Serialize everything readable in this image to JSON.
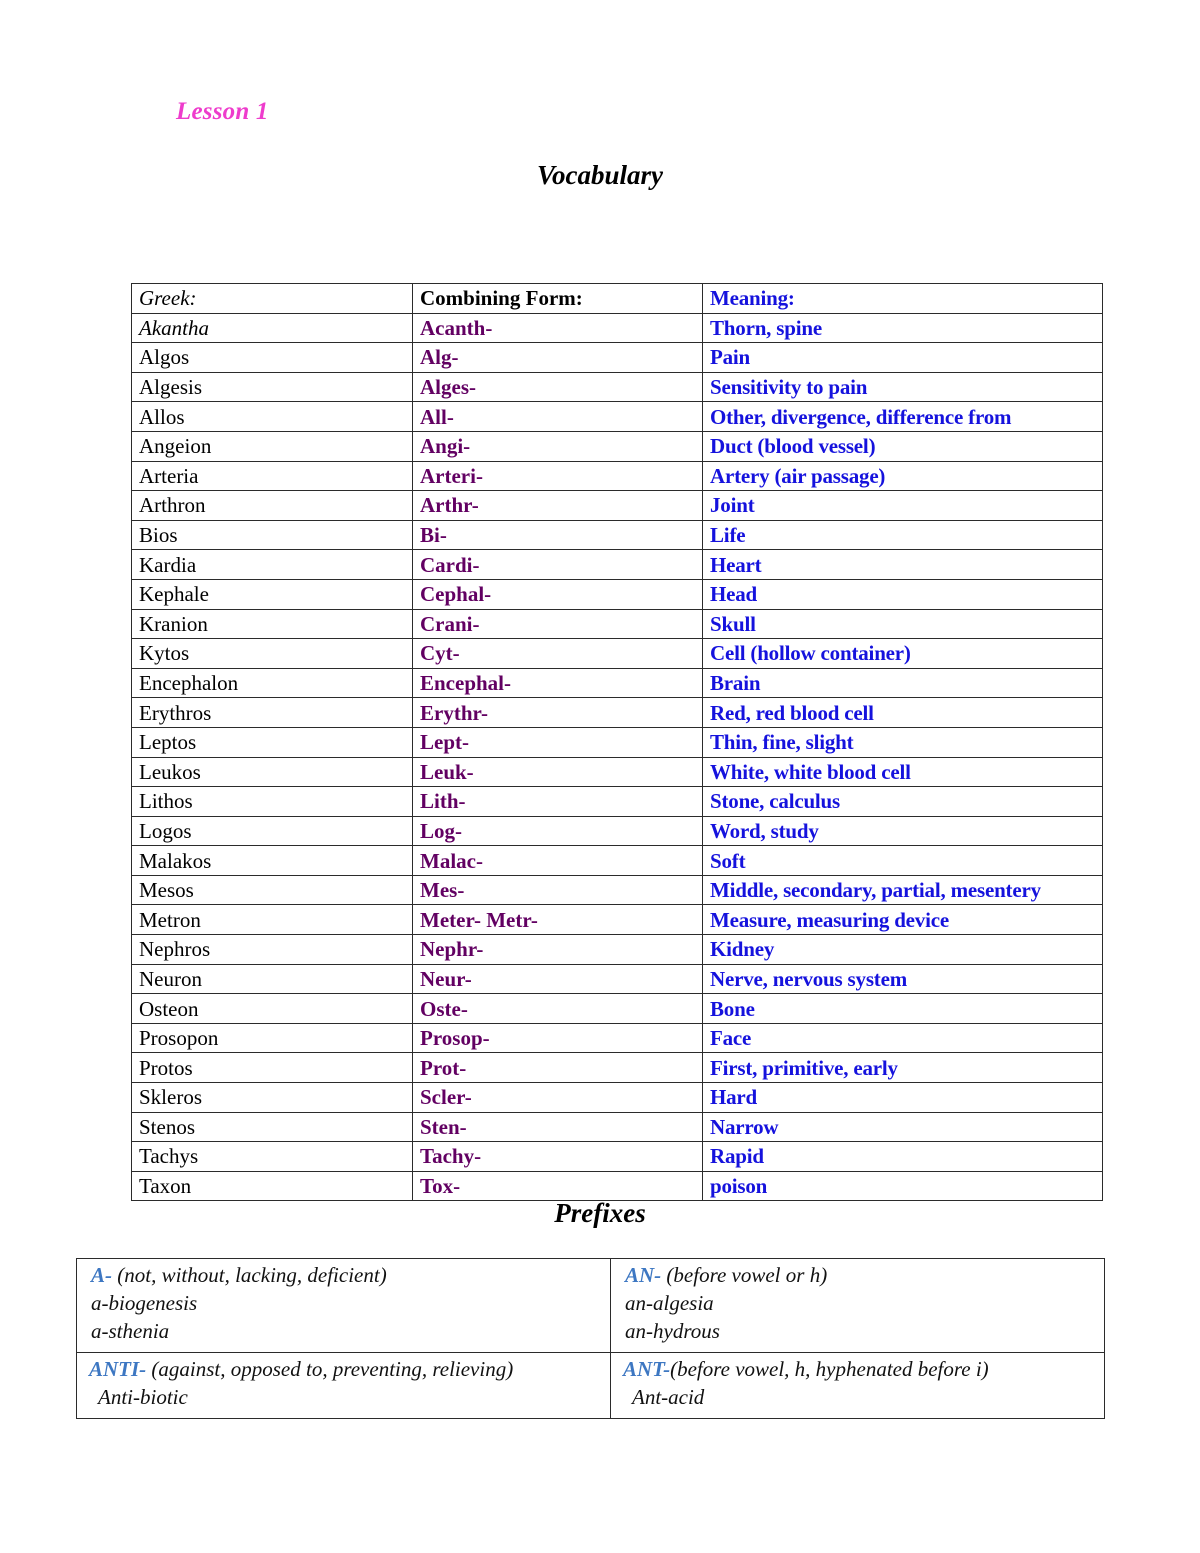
{
  "document": {
    "lesson_title": "Lesson 1",
    "vocabulary_heading": "Vocabulary",
    "prefixes_heading": "Prefixes"
  },
  "colors": {
    "lesson_title": "#ee3ccc",
    "combining_form": "#620062",
    "meaning": "#1512dd",
    "prefix_label": "#3d77c2",
    "border": "#2b2b2b",
    "text": "#000000"
  },
  "vocab_table": {
    "headers": {
      "greek": "Greek:",
      "form": "Combining Form:",
      "meaning": "Meaning:"
    },
    "rows": [
      {
        "greek": "Akantha",
        "form": "Acanth-",
        "meaning": "Thorn, spine"
      },
      {
        "greek": "Algos",
        "form": "Alg-",
        "meaning": "Pain"
      },
      {
        "greek": "Algesis",
        "form": "Alges-",
        "meaning": "Sensitivity to pain"
      },
      {
        "greek": "Allos",
        "form": "All-",
        "meaning": "Other, divergence, difference from"
      },
      {
        "greek": "Angeion",
        "form": "Angi-",
        "meaning": "Duct (blood vessel)"
      },
      {
        "greek": "Arteria",
        "form": "Arteri-",
        "meaning": "Artery (air passage)"
      },
      {
        "greek": "Arthron",
        "form": "Arthr-",
        "meaning": "Joint"
      },
      {
        "greek": "Bios",
        "form": "Bi-",
        "meaning": "Life"
      },
      {
        "greek": "Kardia",
        "form": "Cardi-",
        "meaning": "Heart"
      },
      {
        "greek": "Kephale",
        "form": "Cephal-",
        "meaning": "Head"
      },
      {
        "greek": "Kranion",
        "form": "Crani-",
        "meaning": "Skull"
      },
      {
        "greek": "Kytos",
        "form": "Cyt-",
        "meaning": "Cell (hollow container)"
      },
      {
        "greek": "Encephalon",
        "form": "Encephal-",
        "meaning": "Brain"
      },
      {
        "greek": "Erythros",
        "form": "Erythr-",
        "meaning": "Red, red blood cell"
      },
      {
        "greek": "Leptos",
        "form": "Lept-",
        "meaning": "Thin, fine, slight"
      },
      {
        "greek": "Leukos",
        "form": "Leuk-",
        "meaning": "White, white blood cell"
      },
      {
        "greek": "Lithos",
        "form": "Lith-",
        "meaning": "Stone, calculus"
      },
      {
        "greek": "Logos",
        "form": "Log-",
        "meaning": "Word, study"
      },
      {
        "greek": "Malakos",
        "form": "Malac-",
        "meaning": "Soft"
      },
      {
        "greek": "Mesos",
        "form": "Mes-",
        "meaning": "Middle, secondary, partial, mesentery"
      },
      {
        "greek": "Metron",
        "form": "Meter- Metr-",
        "meaning": "Measure, measuring device"
      },
      {
        "greek": "Nephros",
        "form": "Nephr-",
        "meaning": "Kidney"
      },
      {
        "greek": "Neuron",
        "form": "Neur-",
        "meaning": "Nerve, nervous system"
      },
      {
        "greek": "Osteon",
        "form": "Oste-",
        "meaning": "Bone"
      },
      {
        "greek": "Prosopon",
        "form": "Prosop-",
        "meaning": "Face"
      },
      {
        "greek": "Protos",
        "form": "Prot-",
        "meaning": "First, primitive, early"
      },
      {
        "greek": "Skleros",
        "form": "Scler-",
        "meaning": "Hard"
      },
      {
        "greek": "Stenos",
        "form": "Sten-",
        "meaning": "Narrow"
      },
      {
        "greek": "Tachys",
        "form": "Tachy-",
        "meaning": "Rapid"
      },
      {
        "greek": "Taxon",
        "form": "Tox-",
        "meaning": "poison"
      }
    ]
  },
  "prefix_table": {
    "cells": [
      {
        "label": "A-",
        "definition": " (not, without, lacking, deficient)",
        "examples": [
          "a-biogenesis",
          "a-sthenia"
        ]
      },
      {
        "label": "AN-",
        "definition": " (before vowel or h)",
        "examples": [
          "an-algesia",
          "an-hydrous"
        ]
      },
      {
        "label": "ANTI-",
        "definition": " (against, opposed to, preventing, relieving)",
        "examples": [
          "Anti-biotic"
        ]
      },
      {
        "label": "ANT-",
        "definition": "(before vowel, h, hyphenated before i)",
        "examples": [
          "Ant-acid"
        ]
      }
    ]
  }
}
